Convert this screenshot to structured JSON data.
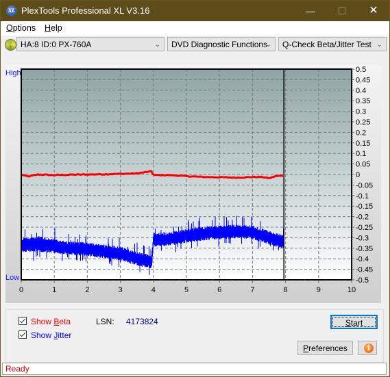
{
  "window": {
    "title": "PlexTools Professional XL V3.16",
    "app_icon": "XL",
    "controls": {
      "minimize": "—",
      "maximize": "☐",
      "close": "✕"
    }
  },
  "menu": {
    "items": [
      {
        "label": "Options",
        "accel": "O"
      },
      {
        "label": "Help",
        "accel": "H"
      }
    ]
  },
  "toolbar": {
    "drive": "HA:8 ID:0  PX-760A",
    "function_group": "DVD Diagnostic Functions",
    "test": "Q-Check Beta/Jitter Test"
  },
  "chart_labels": {
    "high": "High",
    "low": "Low"
  },
  "controls": {
    "show_beta": {
      "label_pre": "Show ",
      "label_accel": "B",
      "label_post": "eta",
      "checked": true,
      "color": "#ff0000"
    },
    "show_jitter": {
      "label_pre": "Show ",
      "label_accel": "J",
      "label_post": "itter",
      "checked": true,
      "color": "#0000ff"
    },
    "lsn_label": "LSN:",
    "lsn_value": "4173824",
    "start_accel": "S",
    "start_rest": "tart",
    "preferences_accel": "P",
    "preferences_rest": "references",
    "info_glyph": "i"
  },
  "status": {
    "text": "Ready"
  },
  "chart_data": {
    "type": "line",
    "title": "",
    "xlabel": "",
    "ylabel": "",
    "xlim": [
      0,
      10
    ],
    "ylim": [
      -0.5,
      0.5
    ],
    "x_ticks": [
      0,
      1,
      2,
      3,
      4,
      5,
      6,
      7,
      8,
      9,
      10
    ],
    "y_ticks": [
      0.5,
      0.45,
      0.4,
      0.35,
      0.3,
      0.25,
      0.2,
      0.15,
      0.1,
      0.05,
      0,
      -0.05,
      -0.1,
      -0.15,
      -0.2,
      -0.25,
      -0.3,
      -0.35,
      -0.4,
      -0.45,
      -0.5
    ],
    "y_tick_labels": [
      "0.5",
      "0.45",
      "0.4",
      "0.35",
      "0.3",
      "0.25",
      "0.2",
      "0.15",
      "0.1",
      "0.05",
      "0",
      "-0.05",
      "-0.1",
      "-0.15",
      "-0.2",
      "-0.25",
      "-0.3",
      "-0.35",
      "-0.4",
      "-0.45",
      "-0.5"
    ],
    "grid": true,
    "end_marker_x": 7.95,
    "series": [
      {
        "name": "Beta",
        "color": "#ff0000",
        "x": [
          0,
          0.2,
          0.5,
          1,
          1.5,
          2,
          2.5,
          3,
          3.5,
          3.8,
          3.95,
          4.0,
          4.5,
          5,
          5.5,
          6,
          6.5,
          7,
          7.3,
          7.5,
          7.7,
          7.95
        ],
        "values": [
          0.0,
          -0.01,
          0.0,
          -0.003,
          -0.001,
          0.0,
          0.001,
          0.003,
          0.005,
          0.012,
          0.015,
          -0.003,
          -0.003,
          -0.008,
          -0.012,
          -0.013,
          -0.015,
          -0.012,
          -0.012,
          -0.018,
          -0.008,
          -0.005
        ]
      },
      {
        "name": "Jitter",
        "color": "#0000ff",
        "x": [
          0,
          0.5,
          1,
          1.5,
          2,
          2.5,
          3,
          3.5,
          3.95,
          4.0,
          4.5,
          5,
          5.5,
          6,
          6.5,
          7,
          7.5,
          7.95
        ],
        "values": [
          -0.335,
          -0.33,
          -0.34,
          -0.35,
          -0.355,
          -0.365,
          -0.375,
          -0.4,
          -0.415,
          -0.31,
          -0.305,
          -0.29,
          -0.28,
          -0.275,
          -0.27,
          -0.275,
          -0.3,
          -0.32
        ],
        "band_halfwidth": [
          0.03,
          0.035,
          0.03,
          0.03,
          0.03,
          0.03,
          0.03,
          0.03,
          0.03,
          0.03,
          0.03,
          0.03,
          0.03,
          0.03,
          0.03,
          0.03,
          0.03,
          0.03
        ]
      }
    ]
  }
}
